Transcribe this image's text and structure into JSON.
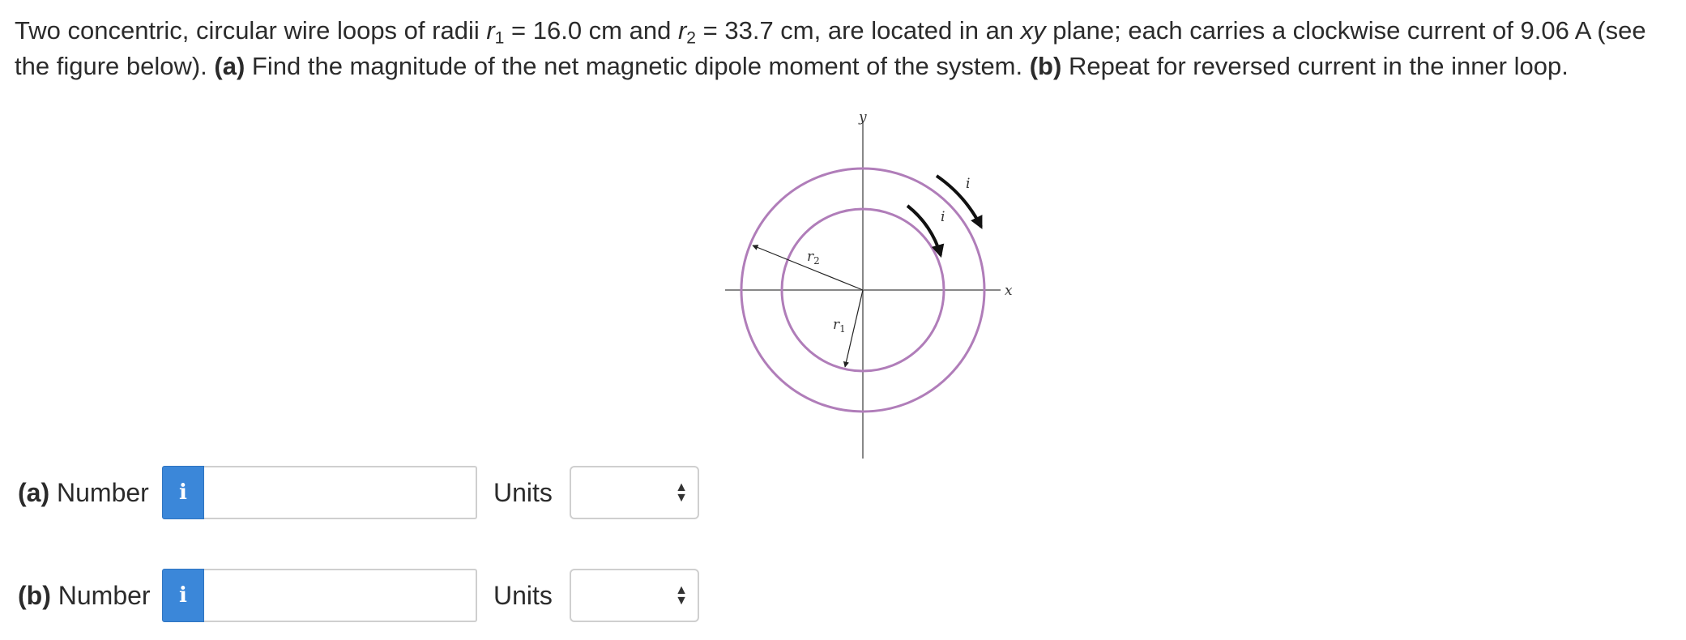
{
  "problem": {
    "p1": "Two concentric, circular wire loops of radii ",
    "r1_sym": "r",
    "r1_sub": "1",
    "p2": " = 16.0 cm and ",
    "r2_sym": "r",
    "r2_sub": "2",
    "p3": " = 33.7 cm, are located in an ",
    "xy": "xy",
    "p4": " plane; each carries a clockwise current of 9.06 A (see the figure below). ",
    "a_tag": "(a)",
    "p5": " Find the magnitude of the net magnetic dipole moment of the system. ",
    "b_tag": "(b)",
    "p6": " Repeat for reversed current in the inner loop."
  },
  "figure": {
    "y_label": "y",
    "x_label": "x",
    "i_outer": "i",
    "i_inner": "i",
    "r1_label": "r",
    "r1_label_sub": "1",
    "r2_label": "r",
    "r2_label_sub": "2",
    "loop_color": "#b07db9"
  },
  "answers": {
    "a": {
      "tag": "(a)",
      "label": " Number",
      "info_icon": "i",
      "value": "",
      "units_label": "Units",
      "units_value": ""
    },
    "b": {
      "tag": "(b)",
      "label": " Number",
      "info_icon": "i",
      "value": "",
      "units_label": "Units",
      "units_value": ""
    }
  }
}
